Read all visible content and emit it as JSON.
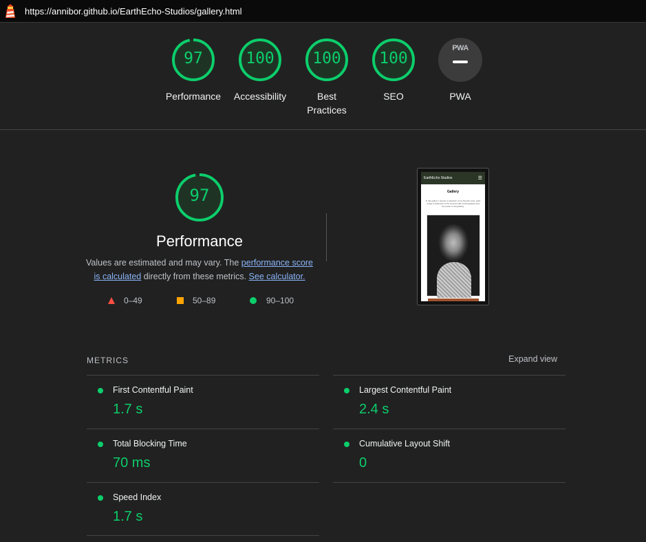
{
  "browser": {
    "url": "https://annibor.github.io/EarthEcho-Studios/gallery.html",
    "logo_icon": "lighthouse-icon"
  },
  "colors": {
    "pass": "#0cce6b",
    "average": "#ffa400",
    "fail": "#ff4e42",
    "pwa": "#9aa0a6"
  },
  "summary_gauges": [
    {
      "score": "97",
      "label": "Performance",
      "value": 0.97
    },
    {
      "score": "100",
      "label": "Accessibility",
      "value": 1.0
    },
    {
      "score": "100",
      "label": "Best Practices",
      "value": 1.0
    },
    {
      "score": "100",
      "label": "SEO",
      "value": 1.0
    },
    {
      "badge": "PWA",
      "label": "PWA"
    }
  ],
  "performance": {
    "score": "97",
    "value": 0.97,
    "title": "Performance",
    "desc_prefix": "Values are estimated and may vary. The ",
    "desc_link1": "performance score is calculated",
    "desc_middle": " directly from these metrics. ",
    "desc_link2": "See calculator."
  },
  "legend": [
    {
      "range": "0–49",
      "shape": "triangle"
    },
    {
      "range": "50–89",
      "shape": "square"
    },
    {
      "range": "90–100",
      "shape": "circle"
    }
  ],
  "screenshot": {
    "site_name": "EarthEcho Studios",
    "menu_icon": "hamburger-icon",
    "page_title": "Gallery",
    "intro_text": "In this gallery I present a selection of my favorite work, each image a testament to the art and craft of photography and the power of storytelling."
  },
  "metrics": {
    "label": "METRICS",
    "expand_label": "Expand view",
    "items": [
      {
        "name": "First Contentful Paint",
        "value": "1.7 s"
      },
      {
        "name": "Largest Contentful Paint",
        "value": "2.4 s"
      },
      {
        "name": "Total Blocking Time",
        "value": "70 ms"
      },
      {
        "name": "Cumulative Layout Shift",
        "value": "0"
      },
      {
        "name": "Speed Index",
        "value": "1.7 s"
      }
    ]
  }
}
